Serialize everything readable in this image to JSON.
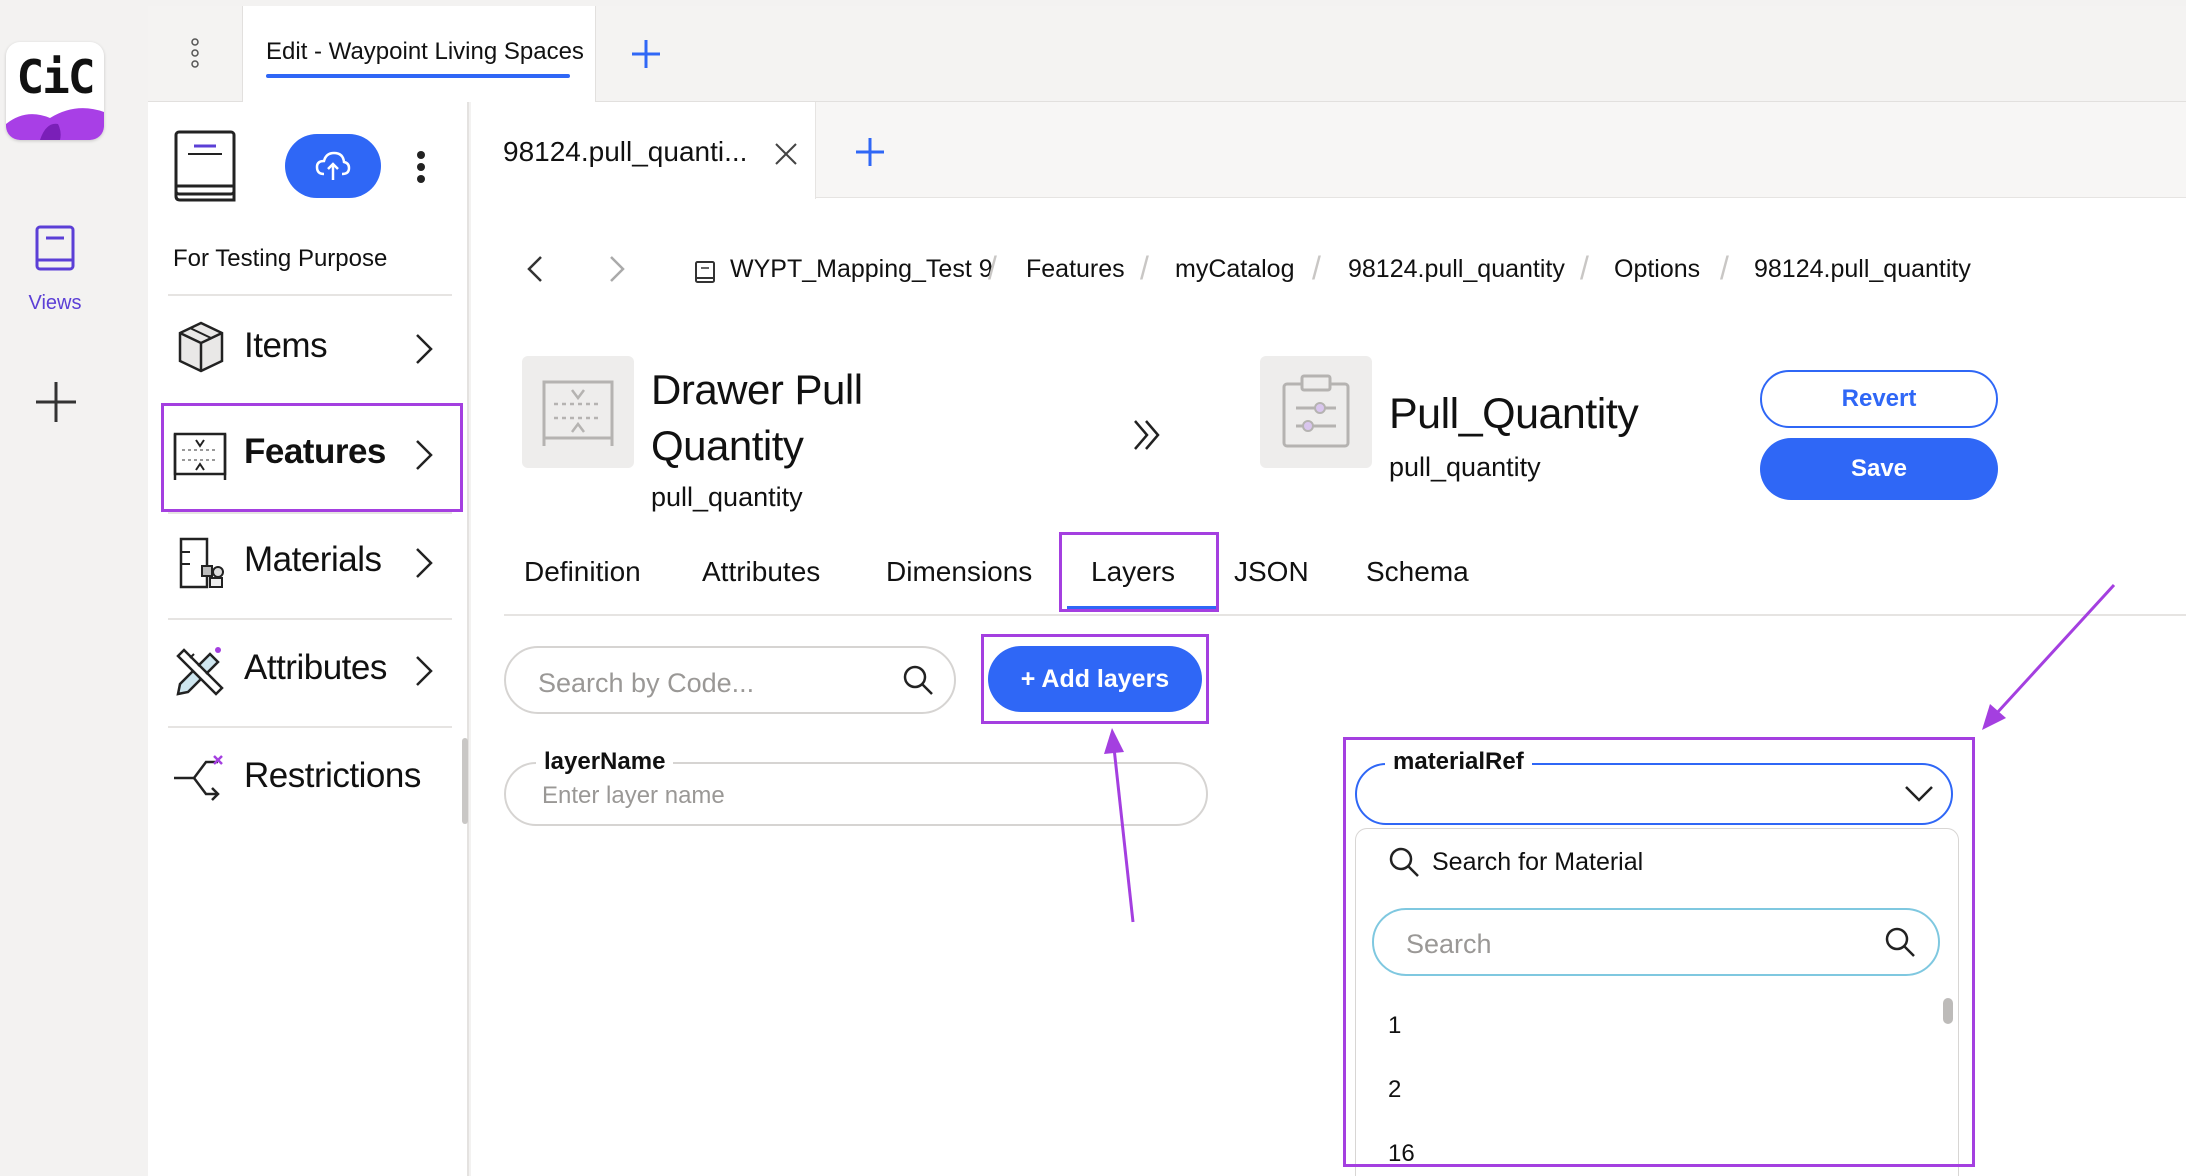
{
  "rail": {
    "logo_text": "CiC",
    "views_label": "Views"
  },
  "top_tab": {
    "label": "Edit - Waypoint Living Spaces"
  },
  "nav": {
    "catalog_name": "For Testing Purpose",
    "items": [
      {
        "label": "Items",
        "icon": "cube-icon"
      },
      {
        "label": "Features",
        "icon": "feature-frame-icon",
        "selected": true
      },
      {
        "label": "Materials",
        "icon": "materials-icon"
      },
      {
        "label": "Attributes",
        "icon": "pencil-ruler-icon"
      },
      {
        "label": "Restrictions",
        "icon": "branch-icon"
      }
    ]
  },
  "inner_tab": {
    "label": "98124.pull_quanti..."
  },
  "breadcrumb": [
    "WYPT_Mapping_Test 9",
    "Features",
    "myCatalog",
    "98124.pull_quantity",
    "Options",
    "98124.pull_quantity"
  ],
  "feature": {
    "title": "Drawer Pull Quantity",
    "code": "pull_quantity"
  },
  "option": {
    "title": "Pull_Quantity",
    "code": "pull_quantity"
  },
  "actions": {
    "revert": "Revert",
    "save": "Save"
  },
  "detail_tabs": [
    "Definition",
    "Attributes",
    "Dimensions",
    "Layers",
    "JSON",
    "Schema"
  ],
  "active_tab": "Layers",
  "layers": {
    "search_placeholder": "Search by Code...",
    "add_label": "+ Add layers",
    "layer_name_label": "layerName",
    "layer_name_placeholder": "Enter layer name",
    "material_ref_label": "materialRef",
    "dropdown": {
      "title": "Search for Material",
      "search_placeholder": "Search",
      "options": [
        "1",
        "2",
        "16"
      ]
    }
  },
  "colors": {
    "accent": "#2f67f6",
    "highlight": "#a43fe0",
    "logo_purple": "#a83fe6"
  }
}
